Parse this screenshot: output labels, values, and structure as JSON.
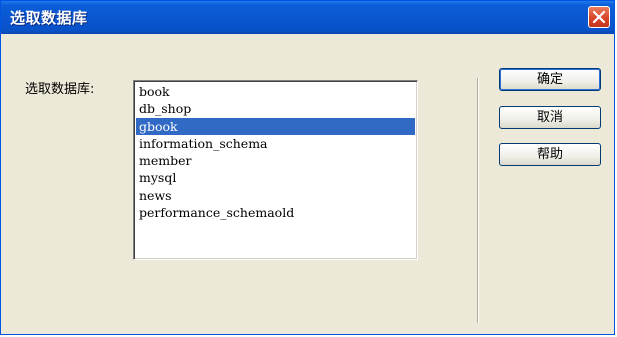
{
  "window": {
    "title": "选取数据库"
  },
  "dialog": {
    "label": "选取数据库:",
    "databases": [
      "book",
      "db_shop",
      "gbook",
      "information_schema",
      "member",
      "mysql",
      "news",
      "performance_schemaold"
    ],
    "selected_database": "gbook"
  },
  "buttons": {
    "ok": "确定",
    "cancel": "取消",
    "help": "帮助"
  },
  "colors": {
    "titlebar": "#0a57d1",
    "selection": "#316ac5",
    "close_button": "#d9452a",
    "dialog_background": "#ece9d8"
  }
}
